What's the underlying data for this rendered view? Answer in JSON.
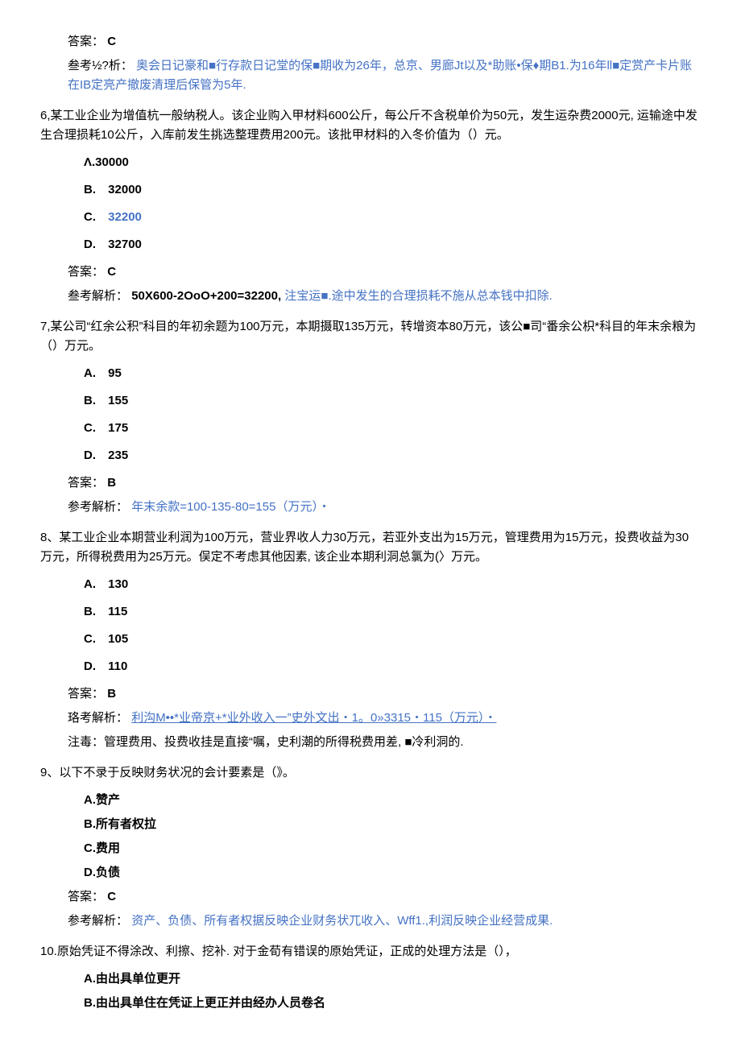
{
  "q5": {
    "answer_label": "答案：",
    "answer_value": "C",
    "analysis_label": "叁考½?析：",
    "analysis_text": "奥会日记豪和■行存款日记堂的保■期收为26年，总京、男廊Jt以及*助账•保♦期B1.为16年ll■定赏产卡片账在IB定亮产撤废清理后保管为5年."
  },
  "q6": {
    "stem": "6,某工业企业为增值杭一般纳税人。该企业购入甲材料600公斤，每公斤不含税单价为50元，发生运杂费2000元, 运输途中发生合理损耗10公斤，入库前发生挑选整理费用200元。该批甲材料的入冬价值为（）元。",
    "optA": "Λ.30000",
    "optB_letter": "B.",
    "optB_text": "32000",
    "optC_letter": "C.",
    "optC_text": "32200",
    "optD_letter": "D.",
    "optD_text": "32700",
    "answer_label": "答案：",
    "answer_value": "C",
    "analysis_label": "叁考解析：",
    "analysis_bold": "50X600-2OoO+200=32200,",
    "analysis_blue": "注宝运■.途中发生的合理损耗不施从总本钱中扣除."
  },
  "q7": {
    "stem": "7,某公司“红余公积”科目的年初余题为100万元，本期摄取135万元，转增资本80万元，该公■司“番余公枳*科目的年末余粮为（）万元。",
    "optA_letter": "A.",
    "optA_text": "95",
    "optB_letter": "B.",
    "optB_text": "155",
    "optC_letter": "C.",
    "optC_text": "175",
    "optD_letter": "D.",
    "optD_text": "235",
    "answer_label": "答案：",
    "answer_value": "B",
    "analysis_label": "参考解析：",
    "analysis_text": "年末余款=100-135-80=155（万元）・"
  },
  "q8": {
    "stem": "8、某工业企业本期营业利润为100万元，营业界收人力30万元，若亚外支出为15万元，管理费用为15万元，投费收益为30万元，所得税费用为25万元。俣定不考虑其他因素, 该企业本期利洞总氯为(〉万元。",
    "optA_letter": "A.",
    "optA_text": "130",
    "optB_letter": "B.",
    "optB_text": "115",
    "optC_letter": "C.",
    "optC_text": "105",
    "optD_letter": "D.",
    "optD_text": "110",
    "answer_label": "答案：",
    "answer_value": "B",
    "analysis_label": "珞考解析：",
    "analysis_link": "利沟M••*业帝京+*业外收入一”史外文出・1。0»3315・115（万元）・",
    "note": "注毒：管理费用、投费收挂是直接“嘱，史利潮的所得税费用差, ■冷利洞的."
  },
  "q9": {
    "stem": "9、以下不录于反映财务状况的会计要素是（》。",
    "optA": "A.赞产",
    "optB": "B.所有者权拉",
    "optC": "C.费用",
    "optD": "D.负债",
    "answer_label": "答案：",
    "answer_value": "C",
    "analysis_label": "参考解析：",
    "analysis_text": "资产、负债、所有者权据反映企业财务状兀收入、Wff1.,利润反映企业经营成果."
  },
  "q10": {
    "stem": "10.原始凭证不得涂改、利擦、挖补. 对于金荀有错误的原始凭证，正成的处理方法是（），",
    "optA": "A.由出具单位更开",
    "optB": "B.由出具单住在凭证上更正并由经办人员卷名"
  }
}
